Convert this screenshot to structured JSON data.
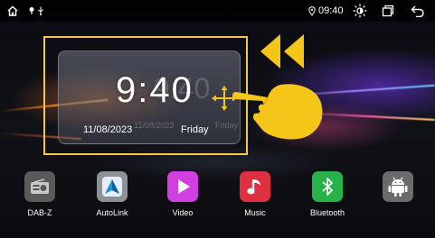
{
  "status_bar": {
    "time": "09:40",
    "icons": [
      "home-icon",
      "pin-icon",
      "usb-icon",
      "location-icon",
      "brightness-icon",
      "recent-apps-icon",
      "back-icon"
    ]
  },
  "clock": {
    "time": "9:40",
    "date": "11/08/2023",
    "day": "Friday",
    "ghost_time": "9:40",
    "ghost_date": "11/08/2023",
    "ghost_day": "Friday"
  },
  "overlay": {
    "icons": [
      "rewind-arrows-icon",
      "pointing-hand-icon",
      "move-arrows-icon"
    ],
    "accent_color": "#f5c518"
  },
  "dock": {
    "apps": [
      {
        "label": "DAB-Z",
        "icon": "radio-icon",
        "color": "#5a5a5a"
      },
      {
        "label": "AutoLink",
        "icon": "autolink-icon",
        "color": "#8d9299"
      },
      {
        "label": "Video",
        "icon": "play-icon",
        "color": "#d040e0"
      },
      {
        "label": "Music",
        "icon": "music-note-icon",
        "color": "#e03040"
      },
      {
        "label": "Bluetooth",
        "icon": "bluetooth-icon",
        "color": "#27b34a"
      },
      {
        "label": "",
        "icon": "android-icon",
        "color": "#6b6b6b"
      }
    ]
  }
}
